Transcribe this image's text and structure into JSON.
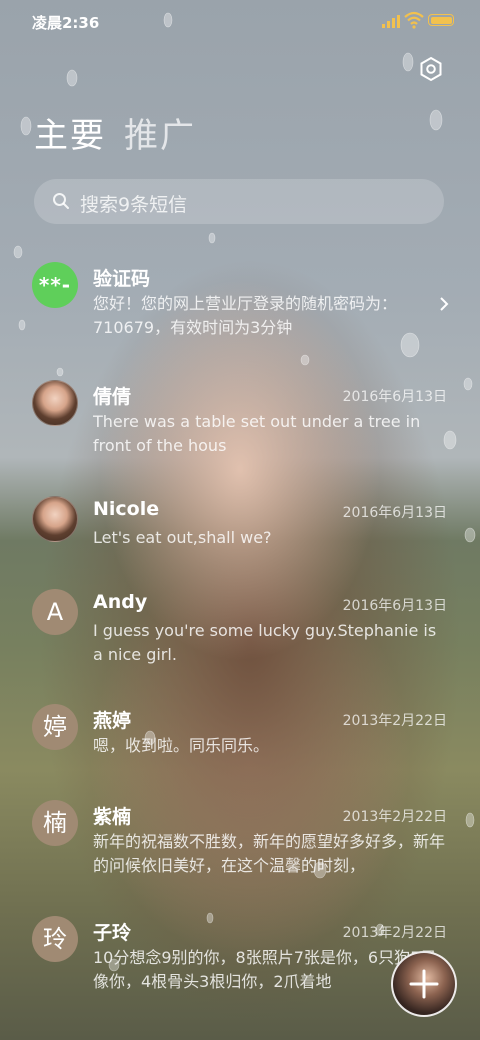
{
  "status_bar": {
    "time": "凌晨2:36"
  },
  "tabs": [
    {
      "label": "主要"
    },
    {
      "label": "推广"
    }
  ],
  "search": {
    "placeholder": "搜索9条短信"
  },
  "conversations": [
    {
      "avatar_text": "**-",
      "avatar_type": "verification",
      "name": "验证码",
      "date": "",
      "preview": "您好！您的网上营业厅登录的随机密码为：710679，有效时间为3分钟"
    },
    {
      "avatar_text": "",
      "avatar_type": "photo",
      "name": "倩倩",
      "date": "2016年6月13日",
      "preview": "There was a table set out under a tree in front of the hous"
    },
    {
      "avatar_text": "",
      "avatar_type": "photo",
      "name": "Nicole",
      "date": "2016年6月13日",
      "preview": "Let's eat out,shall we?"
    },
    {
      "avatar_text": "A",
      "avatar_type": "letter",
      "name": "Andy",
      "date": "2016年6月13日",
      "preview": "I guess you're some lucky guy.Stephanie is a nice girl."
    },
    {
      "avatar_text": "婷",
      "avatar_type": "letter",
      "name": "燕婷",
      "date": "2013年2月22日",
      "preview": "嗯，收到啦。同乐同乐。"
    },
    {
      "avatar_text": "楠",
      "avatar_type": "letter",
      "name": "紫楠",
      "date": "2013年2月22日",
      "preview": "新年的祝福数不胜数，新年的愿望好多好多，新年的问候依旧美好，在这个温馨的时刻，"
    },
    {
      "avatar_text": "玲",
      "avatar_type": "letter",
      "name": "子玲",
      "date": "2013年2月22日",
      "preview": "10分想念9别的你，8张照片7张是你，6只狗5只像你，4根骨头3根归你，2爪着地"
    }
  ],
  "colors": {
    "verification_avatar": "#5fcf5a",
    "letter_avatar": "#a08a73",
    "status_icons": "#f2c14e"
  },
  "icons": {
    "settings": "settings-icon",
    "search": "search-icon",
    "compose": "plus-icon",
    "chevron": "chevron-right-icon"
  }
}
